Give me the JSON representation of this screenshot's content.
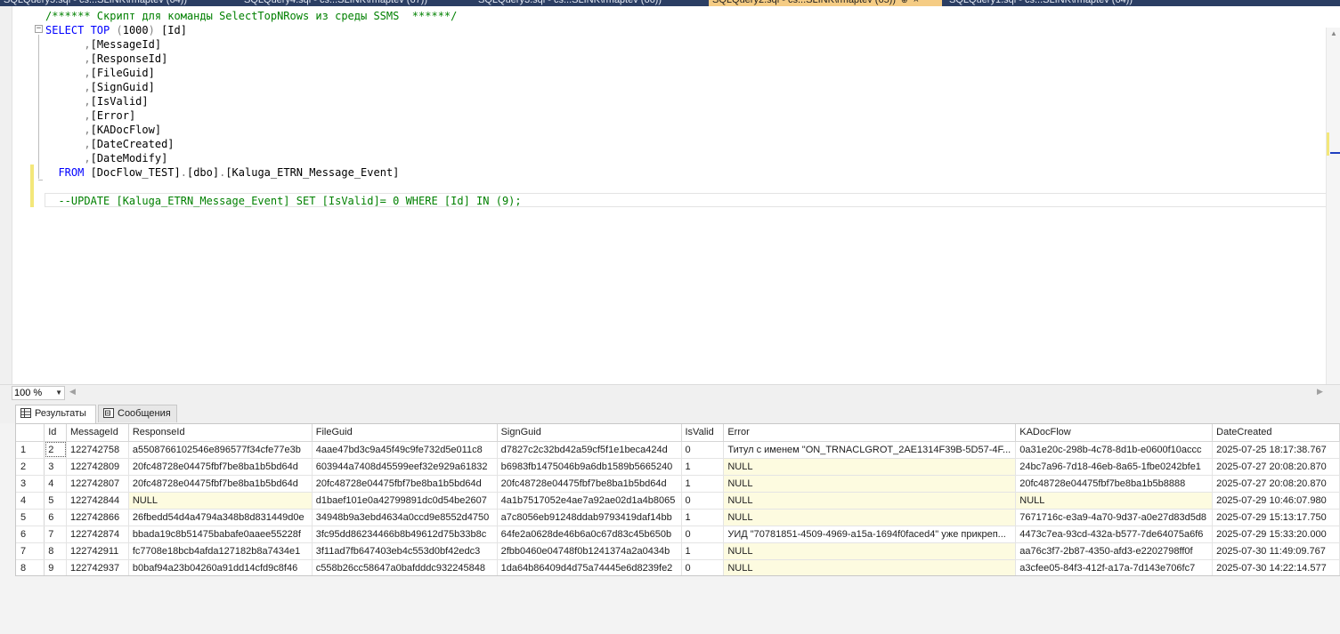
{
  "tabs": [
    {
      "label": "SQLQuery5.sql - cs...SLINK\\rmaptev (64))",
      "active": false
    },
    {
      "label": "SQLQuery4.sql - cs...SLINK\\rmaptev (67))",
      "active": false
    },
    {
      "label": "SQLQuery3.sql - cs...SLINK\\rmaptev (66))",
      "active": false
    },
    {
      "label": "SQLQuery2.sql - cs...SLINK\\rmaptev (65))",
      "active": true
    },
    {
      "label": "SQLQuery1.sql - cs...SLINK\\rmaptev (64))",
      "active": false
    }
  ],
  "editor": {
    "lines": [
      {
        "text": "/****** Скрипт для команды SelectTopNRows из среды SSMS  ******/",
        "kind": "comment"
      },
      {
        "text": "SELECT TOP (1000) [Id]",
        "kind": "select"
      },
      {
        "text": "      ,[MessageId]",
        "kind": "column"
      },
      {
        "text": "      ,[ResponseId]",
        "kind": "column"
      },
      {
        "text": "      ,[FileGuid]",
        "kind": "column"
      },
      {
        "text": "      ,[SignGuid]",
        "kind": "column"
      },
      {
        "text": "      ,[IsValid]",
        "kind": "column"
      },
      {
        "text": "      ,[Error]",
        "kind": "column"
      },
      {
        "text": "      ,[KADocFlow]",
        "kind": "column"
      },
      {
        "text": "      ,[DateCreated]",
        "kind": "column"
      },
      {
        "text": "      ,[DateModify]",
        "kind": "column"
      },
      {
        "text": "  FROM [DocFlow_TEST].[dbo].[Kaluga_ETRN_Message_Event]",
        "kind": "from"
      },
      {
        "text": "",
        "kind": "blank"
      },
      {
        "text": "  --UPDATE [Kaluga_ETRN_Message_Event] SET [IsValid]= 0 WHERE [Id] IN (9);",
        "kind": "comment"
      }
    ]
  },
  "zoom": {
    "value": "100 %"
  },
  "results_tabs": {
    "results": "Результаты",
    "messages": "Сообщения"
  },
  "grid": {
    "columns": [
      "Id",
      "MessageId",
      "ResponseId",
      "FileGuid",
      "SignGuid",
      "IsValid",
      "Error",
      "KADocFlow",
      "DateCreated"
    ],
    "rows": [
      {
        "n": "1",
        "cells": [
          "2",
          "122742758",
          "a5508766102546e896577f34cfe77e3b",
          "4aae47bd3c9a45f49c9fe732d5e011c8",
          "d7827c2c32bd42a59cf5f1e1beca424d",
          "0",
          "Титул с именем \"ON_TRNACLGROT_2AE1314F39B-5D57-4F...",
          "0a31e20c-298b-4c78-8d1b-e0600f10accc",
          "2025-07-25 18:17:38.767"
        ]
      },
      {
        "n": "2",
        "cells": [
          "3",
          "122742809",
          "20fc48728e04475fbf7be8ba1b5bd64d",
          "603944a7408d45599eef32e929a61832",
          "b6983fb1475046b9a6db1589b5665240",
          "1",
          "NULL",
          "24bc7a96-7d18-46eb-8a65-1fbe0242bfe1",
          "2025-07-27 20:08:20.870"
        ]
      },
      {
        "n": "3",
        "cells": [
          "4",
          "122742807",
          "20fc48728e04475fbf7be8ba1b5bd64d",
          "20fc48728e04475fbf7be8ba1b5bd64d",
          "20fc48728e04475fbf7be8ba1b5bd64d",
          "1",
          "NULL",
          "20fc48728e04475fbf7be8ba1b5b8888",
          "2025-07-27 20:08:20.870"
        ]
      },
      {
        "n": "4",
        "cells": [
          "5",
          "122742844",
          "NULL",
          "d1baef101e0a42799891dc0d54be2607",
          "4a1b7517052e4ae7a92ae02d1a4b8065",
          "0",
          "NULL",
          "NULL",
          "2025-07-29 10:46:07.980"
        ]
      },
      {
        "n": "5",
        "cells": [
          "6",
          "122742866",
          "26fbedd54d4a4794a348b8d831449d0e",
          "34948b9a3ebd4634a0ccd9e8552d4750",
          "a7c8056eb91248ddab9793419daf14bb",
          "1",
          "NULL",
          "7671716c-e3a9-4a70-9d37-a0e27d83d5d8",
          "2025-07-29 15:13:17.750"
        ]
      },
      {
        "n": "6",
        "cells": [
          "7",
          "122742874",
          "bbada19c8b51475babafe0aaee55228f",
          "3fc95dd86234466b8b49612d75b33b8c",
          "64fe2a0628de46b6a0c67d83c45b650b",
          "0",
          "УИД \"70781851-4509-4969-a15a-1694f0faced4\" уже прикреп...",
          "4473c7ea-93cd-432a-b577-7de64075a6f6",
          "2025-07-29 15:33:20.000"
        ]
      },
      {
        "n": "7",
        "cells": [
          "8",
          "122742911",
          "fc7708e18bcb4afda127182b8a7434e1",
          "3f11ad7fb647403eb4c553d0bf42edc3",
          "2fbb0460e04748f0b1241374a2a0434b",
          "1",
          "NULL",
          "aa76c3f7-2b87-4350-afd3-e2202798ff0f",
          "2025-07-30 11:49:09.767"
        ]
      },
      {
        "n": "8",
        "cells": [
          "9",
          "122742937",
          "b0baf94a23b04260a91dd14cfd9c8f46",
          "c558b26cc58647a0bafdddc932245848",
          "1da64b86409d4d75a74445e6d8239fe2",
          "0",
          "NULL",
          "a3cfee05-84f3-412f-a17a-7d143e706fc7",
          "2025-07-30 14:22:14.577"
        ]
      }
    ]
  }
}
